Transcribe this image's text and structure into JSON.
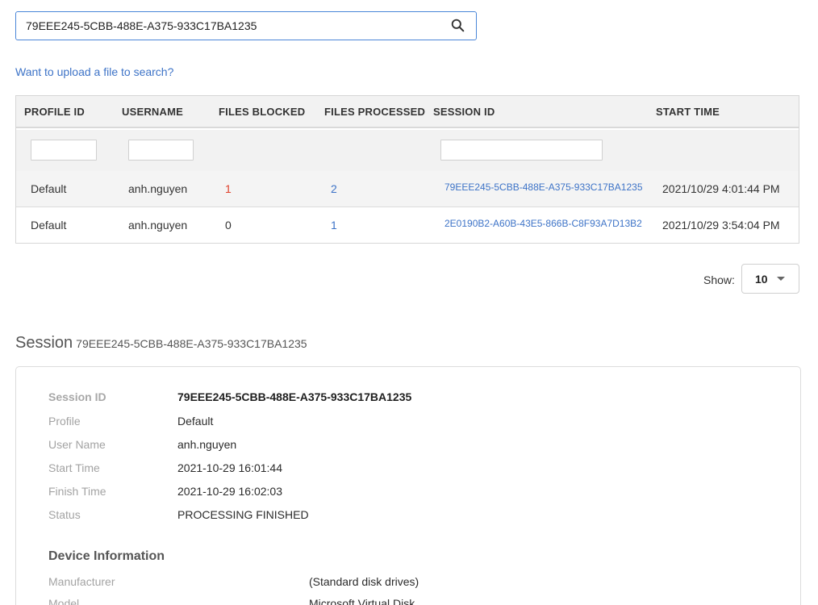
{
  "search": {
    "value": "79EEE245-5CBB-488E-A375-933C17BA1235",
    "icon": "search-icon"
  },
  "upload_link": "Want to upload a file to search?",
  "table": {
    "columns": [
      "PROFILE ID",
      "USERNAME",
      "FILES BLOCKED",
      "FILES PROCESSED",
      "SESSION ID",
      "START TIME"
    ],
    "rows": [
      {
        "profile": "Default",
        "username": "anh.nguyen",
        "blocked": "1",
        "processed": "2",
        "session": "79EEE245-5CBB-488E-A375-933C17BA1235",
        "start_date": "2021/10/29",
        "start_time": "4:01:44 PM"
      },
      {
        "profile": "Default",
        "username": "anh.nguyen",
        "blocked": "0",
        "processed": "1",
        "session": "2E0190B2-A60B-43E5-866B-C8F93A7D13B2",
        "start_date": "2021/10/29",
        "start_time": "3:54:04 PM"
      }
    ]
  },
  "pager": {
    "show_label": "Show:",
    "page_size": "10"
  },
  "session": {
    "title": "Session",
    "id": "79EEE245-5CBB-488E-A375-933C17BA1235",
    "fields": [
      {
        "label": "Session ID",
        "value": "79EEE245-5CBB-488E-A375-933C17BA1235"
      },
      {
        "label": "Profile",
        "value": "Default"
      },
      {
        "label": "User Name",
        "value": "anh.nguyen"
      },
      {
        "label": "Start Time",
        "value": "2021-10-29 16:01:44"
      },
      {
        "label": "Finish Time",
        "value": "2021-10-29 16:02:03"
      },
      {
        "label": "Status",
        "value": "PROCESSING FINISHED"
      }
    ],
    "device_title": "Device Information",
    "device_fields": [
      {
        "label": "Manufacturer",
        "value": "(Standard disk drives)"
      },
      {
        "label": "Model",
        "value": "Microsoft Virtual Disk"
      }
    ]
  },
  "colors": {
    "accent": "#3d73c7",
    "blocked": "#e0412b",
    "header_bg": "#f2f2f2"
  }
}
